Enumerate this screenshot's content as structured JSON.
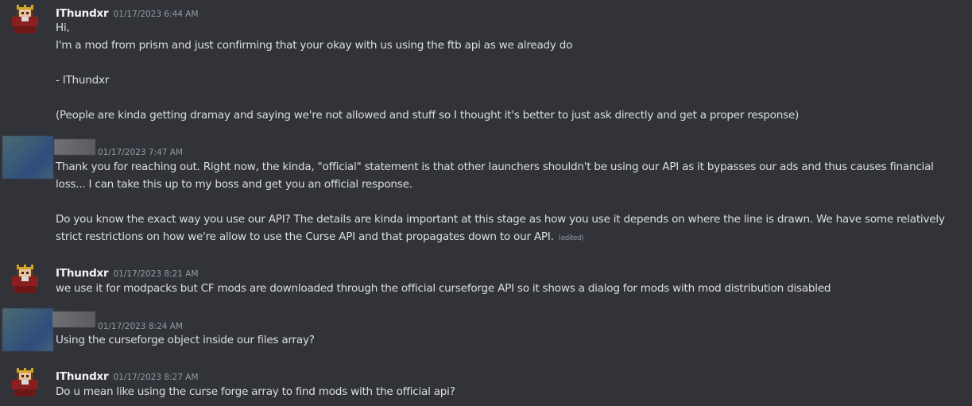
{
  "messages": [
    {
      "author": "IThundxr",
      "timestamp": "01/17/2023 6:44 AM",
      "lines": [
        "Hi,",
        "I'm a mod from prism and just confirming that your okay with us using the ftb api as we already do",
        "- IThundxr",
        "(People are kinda getting dramay and saying we're not allowed and stuff so I thought it's better to just ask directly and get a proper response)"
      ]
    },
    {
      "author": "",
      "timestamp": "01/17/2023 7:47 AM",
      "lines": [
        "Thank you for reaching out. Right now, the kinda, \"official\" statement is that other launchers shouldn't be using our API as it bypasses our ads and thus causes financial",
        "loss... I can take this up to my boss and get you an official response.",
        "Do you know the exact way you use our API? The details are kinda important at this stage as how you use it depends on where the line is drawn. We have some relatively",
        "strict restrictions on how we're allow to use the Curse API and that propagates down to our API."
      ],
      "edited_label": "(edited)"
    },
    {
      "author": "IThundxr",
      "timestamp": "01/17/2023 8:21 AM",
      "lines": [
        "we use it for modpacks but CF mods are downloaded through the official curseforge API so it shows a dialog for mods with mod distribution disabled"
      ]
    },
    {
      "author": "",
      "timestamp": "01/17/2023 8:24 AM",
      "lines": [
        "Using the curseforge object inside our files array?"
      ]
    },
    {
      "author": "IThundxr",
      "timestamp": "01/17/2023 8:27 AM",
      "lines": [
        "Do u mean like using the curse forge array to find mods with the official api?"
      ]
    }
  ],
  "colors": {
    "background": "#313338",
    "text": "#dbdee1",
    "username": "#f2f3f5",
    "muted": "#949ba4"
  },
  "icons": {
    "ithundxr_avatar": "pixel-crown-avatar-icon",
    "blurred_avatar": "blurred-avatar"
  }
}
